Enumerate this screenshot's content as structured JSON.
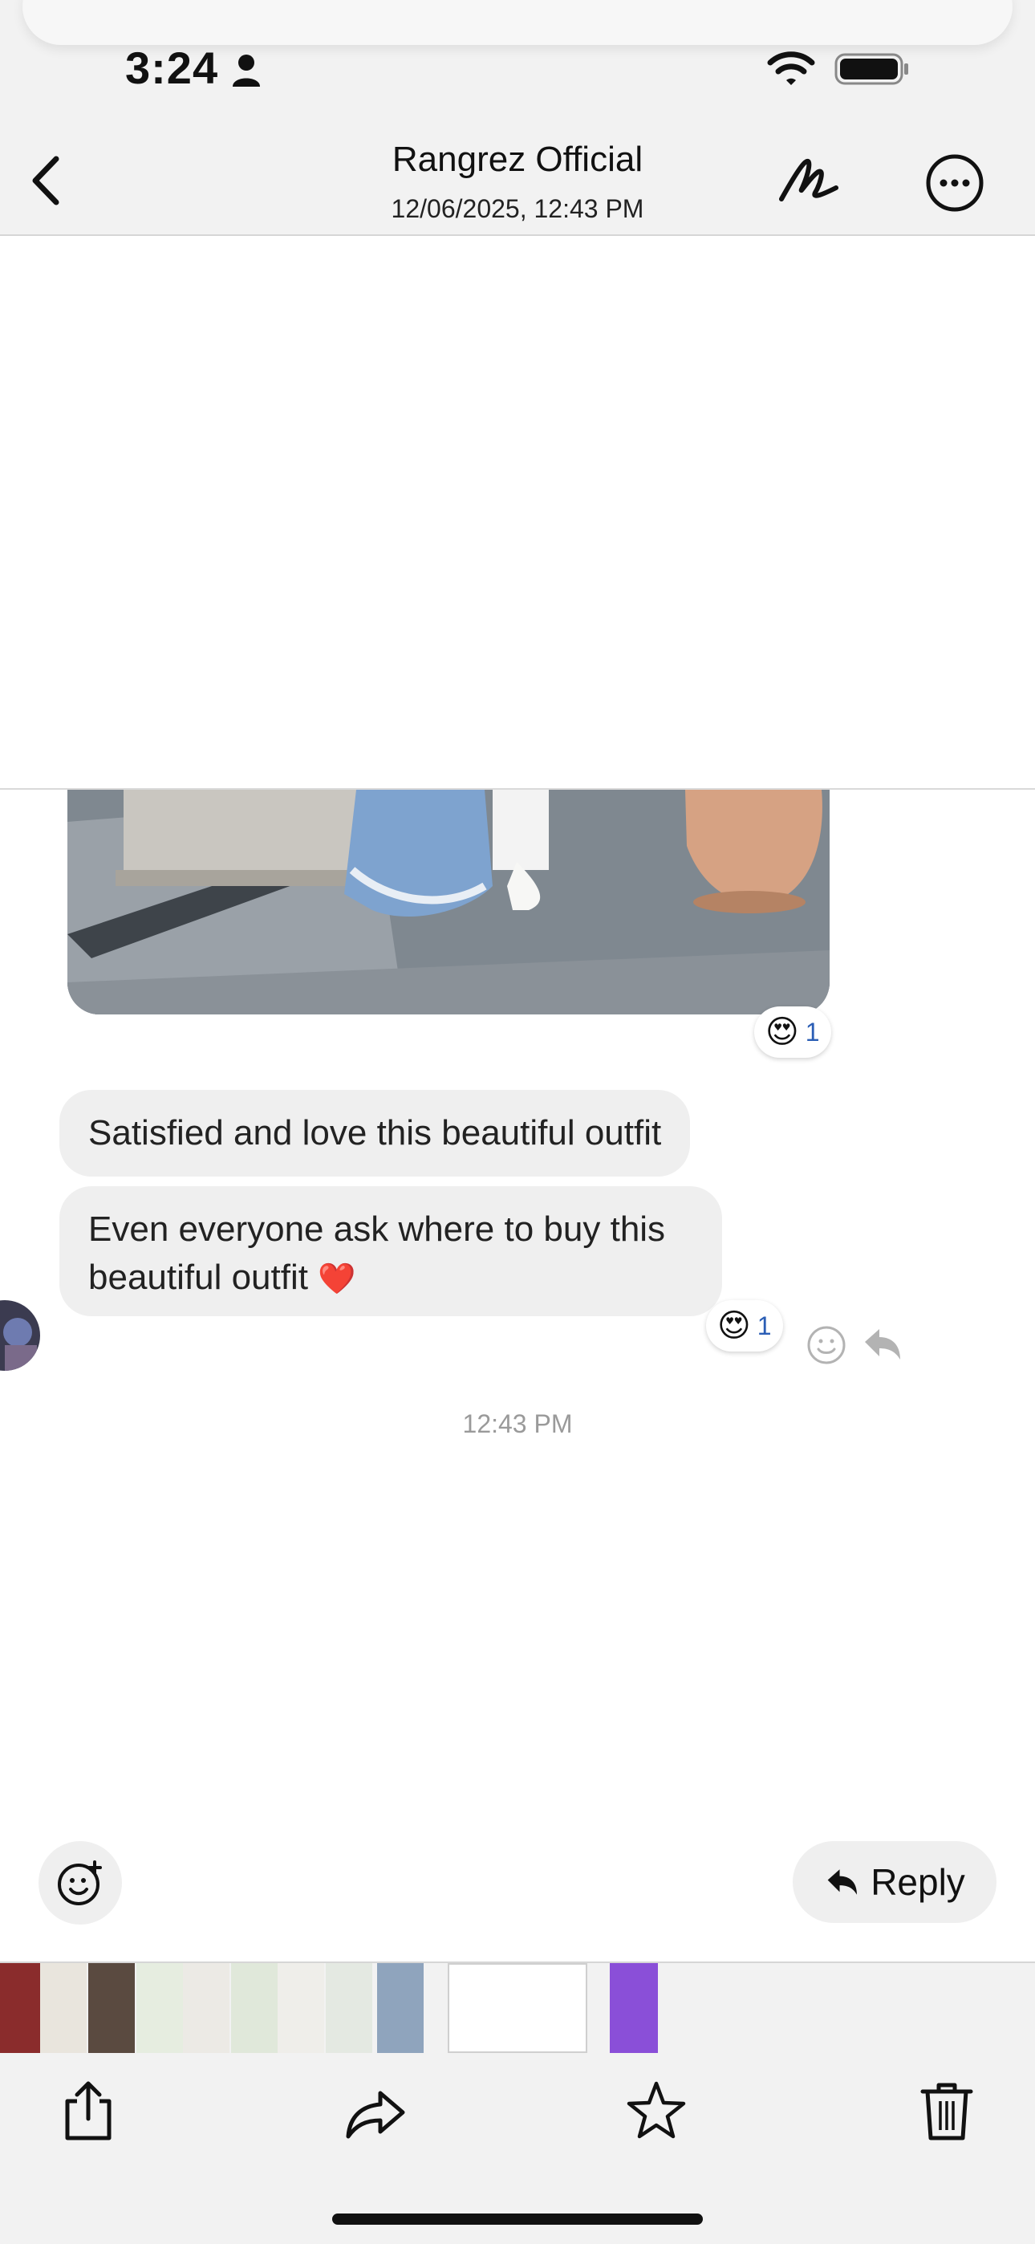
{
  "status_bar": {
    "time": "3:24"
  },
  "header": {
    "title": "Rangrez Official",
    "subtitle": "12/06/2025, 12:43 PM"
  },
  "messages": [
    {
      "text": "Satisfied and love this beautiful outfit"
    },
    {
      "text_line1": "Even everyone ask where to buy this",
      "text_line2": "beautiful outfit",
      "emoji": "❤️"
    }
  ],
  "reactions": {
    "photo": {
      "emoji": "😍",
      "count": "1"
    },
    "message2": {
      "emoji": "😍",
      "count": "1"
    }
  },
  "timestamp": "12:43 PM",
  "reply_button": {
    "label": "Reply"
  },
  "colors": {
    "bubble": "#efefef",
    "reaction_count": "#2b5eb5",
    "chrome": "#f2f2f2"
  }
}
